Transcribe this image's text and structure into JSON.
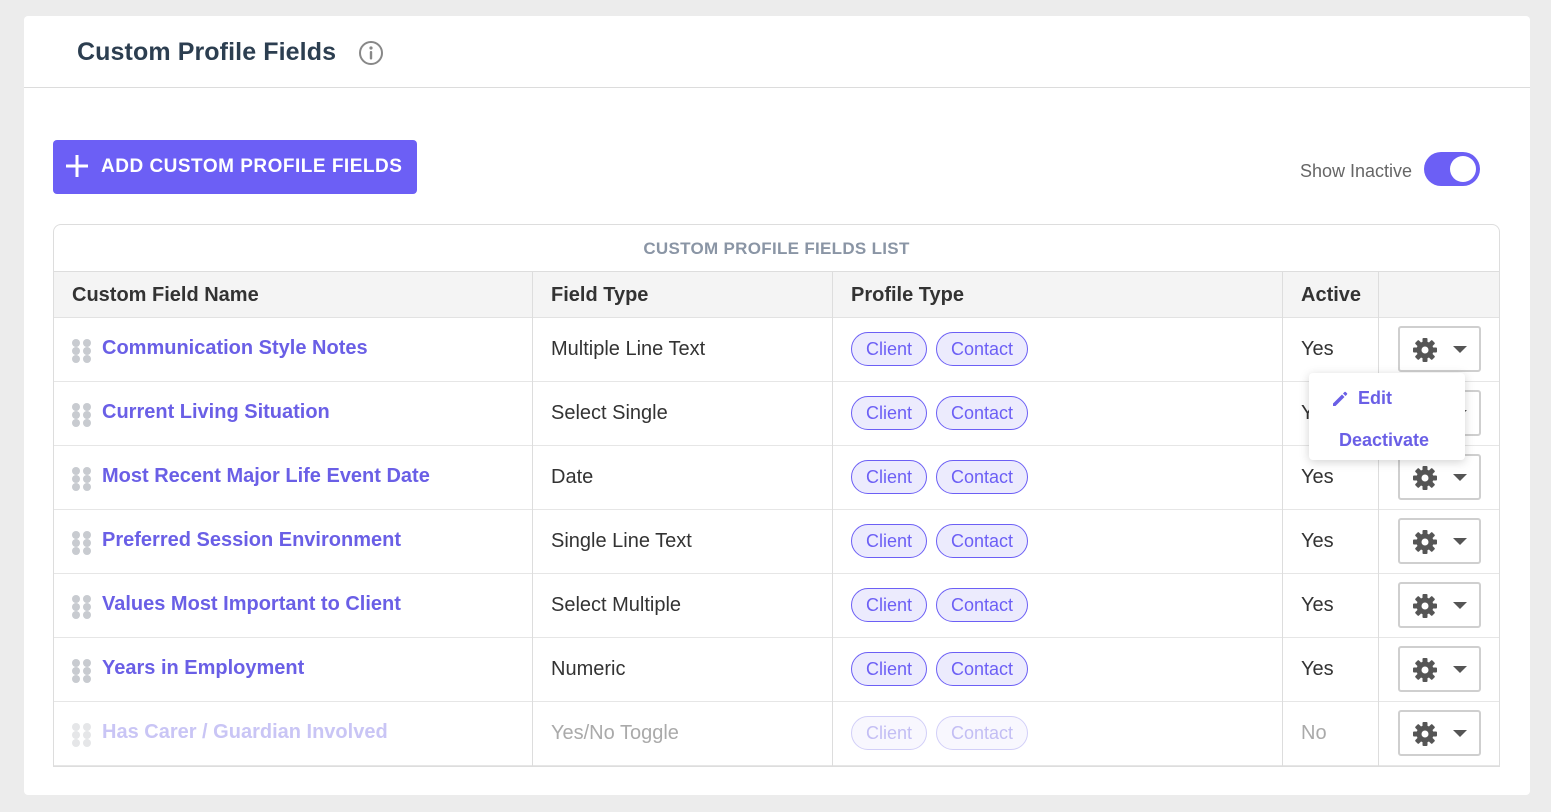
{
  "header": {
    "title": "Custom Profile Fields"
  },
  "toolbar": {
    "add_label": "ADD CUSTOM PROFILE FIELDS",
    "show_inactive_label": "Show Inactive",
    "show_inactive": true
  },
  "table": {
    "title": "CUSTOM PROFILE FIELDS LIST",
    "columns": [
      "Custom Field Name",
      "Field Type",
      "Profile Type",
      "Active",
      ""
    ],
    "rows": [
      {
        "name": "Communication Style Notes",
        "type": "Multiple Line Text",
        "profiles": [
          "Client",
          "Contact"
        ],
        "active": "Yes"
      },
      {
        "name": "Current Living Situation",
        "type": "Select Single",
        "profiles": [
          "Client",
          "Contact"
        ],
        "active": "Yes"
      },
      {
        "name": "Most Recent Major Life Event Date",
        "type": "Date",
        "profiles": [
          "Client",
          "Contact"
        ],
        "active": "Yes"
      },
      {
        "name": "Preferred Session Environment",
        "type": "Single Line Text",
        "profiles": [
          "Client",
          "Contact"
        ],
        "active": "Yes"
      },
      {
        "name": "Values Most Important to Client",
        "type": "Select Multiple",
        "profiles": [
          "Client",
          "Contact"
        ],
        "active": "Yes"
      },
      {
        "name": "Years in Employment",
        "type": "Numeric",
        "profiles": [
          "Client",
          "Contact"
        ],
        "active": "Yes"
      },
      {
        "name": "Has Carer / Guardian Involved",
        "type": "Yes/No Toggle",
        "profiles": [
          "Client",
          "Contact"
        ],
        "active": "No"
      }
    ]
  },
  "dropdown": {
    "edit_label": "Edit",
    "deactivate_label": "Deactivate"
  },
  "colors": {
    "accent": "#6c5ff5",
    "link": "#6a5fe6",
    "background": "#ececec"
  }
}
